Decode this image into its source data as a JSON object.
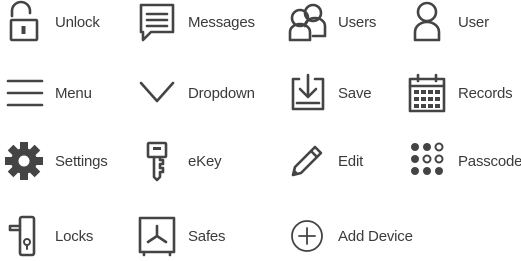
{
  "icons": [
    {
      "label": "Unlock",
      "icon": "unlock-icon"
    },
    {
      "label": "Messages",
      "icon": "messages-icon"
    },
    {
      "label": "Users",
      "icon": "users-icon"
    },
    {
      "label": "User",
      "icon": "user-icon"
    },
    {
      "label": "Menu",
      "icon": "menu-icon"
    },
    {
      "label": "Dropdown",
      "icon": "chevron-down-icon"
    },
    {
      "label": "Save",
      "icon": "save-icon"
    },
    {
      "label": "Records",
      "icon": "calendar-icon"
    },
    {
      "label": "Settings",
      "icon": "gear-icon"
    },
    {
      "label": "eKey",
      "icon": "key-icon"
    },
    {
      "label": "Edit",
      "icon": "pencil-icon"
    },
    {
      "label": "Passcode",
      "icon": "passcode-icon"
    },
    {
      "label": "Locks",
      "icon": "door-lock-icon"
    },
    {
      "label": "Safes",
      "icon": "safe-icon"
    },
    {
      "label": "Add Device",
      "icon": "add-circle-icon"
    }
  ],
  "colors": {
    "icon": "#444444",
    "text": "#3b3b3b",
    "background": "#ffffff"
  }
}
